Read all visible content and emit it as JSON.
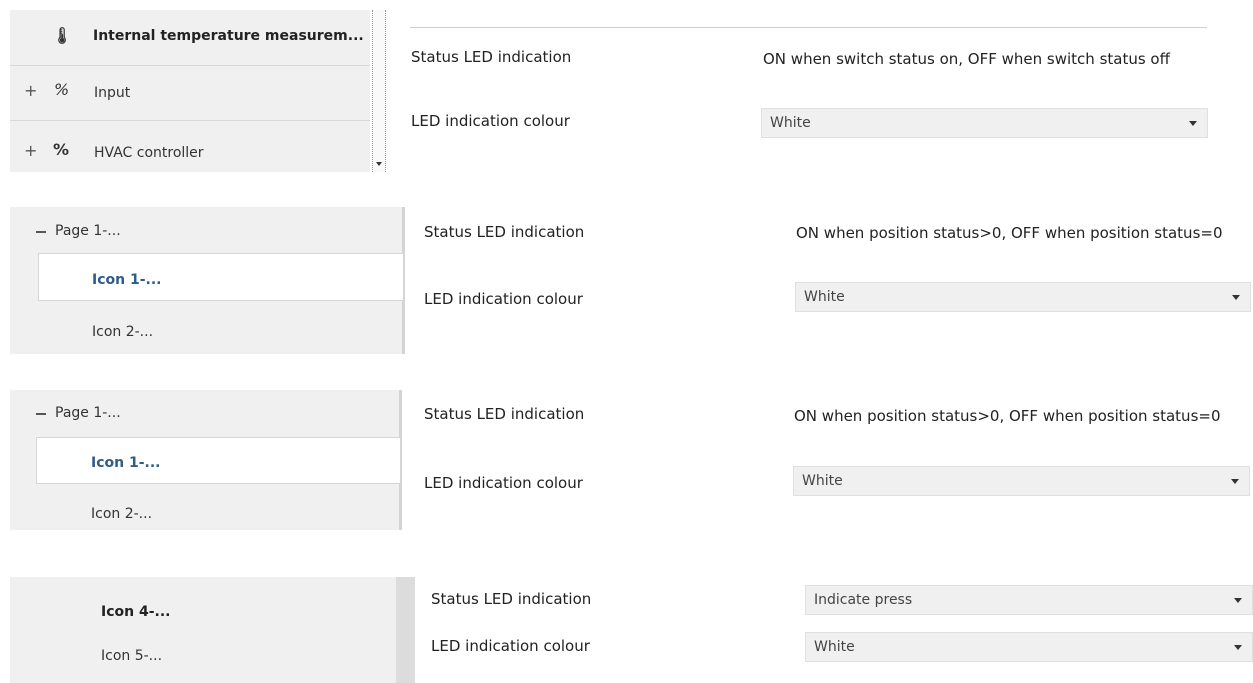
{
  "section1": {
    "tree": [
      {
        "label": "Internal temperature measurem...",
        "icon": "thermometer-icon"
      },
      {
        "label": "Input",
        "icon": "input-icon",
        "expander": "+"
      },
      {
        "label": "HVAC controller",
        "icon": "hvac-icon",
        "expander": "+"
      }
    ],
    "status_label": "Status LED indication",
    "status_value": "ON when switch status on, OFF when switch status off",
    "colour_label": "LED indication colour",
    "colour_value": "White"
  },
  "section2": {
    "tree": [
      {
        "label": "Page 1-...",
        "expander": "−"
      },
      {
        "label": "Icon 1-..."
      },
      {
        "label": "Icon 2-..."
      }
    ],
    "status_label": "Status LED indication",
    "status_value": "ON when position status>0, OFF when position status=0",
    "colour_label": "LED indication colour",
    "colour_value": "White"
  },
  "section3": {
    "tree": [
      {
        "label": "Page 1-...",
        "expander": "−"
      },
      {
        "label": "Icon 1-..."
      },
      {
        "label": "Icon 2-..."
      }
    ],
    "status_label": "Status LED indication",
    "status_value": "ON when position status>0, OFF when position status=0",
    "colour_label": "LED indication colour",
    "colour_value": "White"
  },
  "section4": {
    "tree": [
      {
        "label": "Icon 4-..."
      },
      {
        "label": "Icon 5-..."
      }
    ],
    "status_label": "Status LED indication",
    "status_value": "Indicate press",
    "colour_label": "LED indication colour",
    "colour_value": "White"
  }
}
